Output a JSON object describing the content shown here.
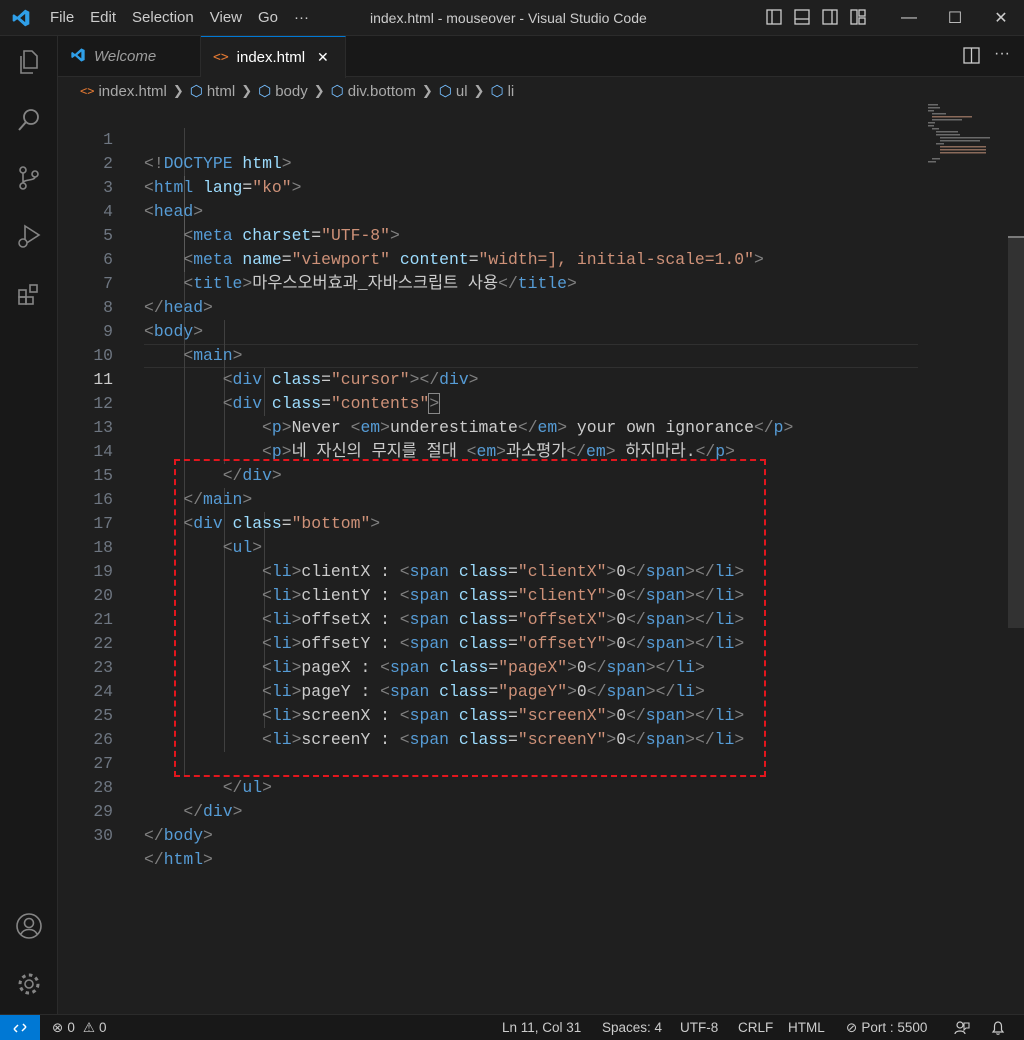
{
  "titlebar": {
    "menu": [
      "File",
      "Edit",
      "Selection",
      "View",
      "Go",
      "···"
    ],
    "window_title": "index.html - mouseover - Visual Studio Code"
  },
  "tabs": [
    {
      "label": "Welcome"
    },
    {
      "label": "index.html",
      "close": "✕"
    }
  ],
  "breadcrumb": [
    "index.html",
    "html",
    "body",
    "div.bottom",
    "ul",
    "li"
  ],
  "lines": [
    "1",
    "2",
    "3",
    "4",
    "5",
    "6",
    "7",
    "8",
    "9",
    "10",
    "11",
    "12",
    "13",
    "14",
    "15",
    "16",
    "17",
    "18",
    "19",
    "20",
    "21",
    "22",
    "23",
    "24",
    "25",
    "26",
    "27",
    "28",
    "29",
    "30"
  ],
  "code": {
    "doctype": "html",
    "lang": "\"ko\"",
    "charset": "\"UTF-8\"",
    "viewport_name": "\"viewport\"",
    "viewport_content": "\"width=], initial-scale=1.0\"",
    "title_text": "마우스오버효과_자바스크립트 사용",
    "cursor_class": "\"cursor\"",
    "contents_class": "\"contents\"",
    "p1_before": "Never ",
    "p1_em": "underestimate",
    "p1_after": " your own ignorance",
    "p2_before": "네 자신의 무지를 절대 ",
    "p2_em": "과소평가",
    "p2_after": " 하지마라.",
    "bottom_class": "\"bottom\"",
    "items": [
      {
        "label": "clientX : ",
        "cls": "\"clientX\"",
        "val": "0"
      },
      {
        "label": "clientY : ",
        "cls": "\"clientY\"",
        "val": "0"
      },
      {
        "label": "offsetX : ",
        "cls": "\"offsetX\"",
        "val": "0"
      },
      {
        "label": "offsetY : ",
        "cls": "\"offsetY\"",
        "val": "0"
      },
      {
        "label": "pageX : ",
        "cls": "\"pageX\"",
        "val": "0"
      },
      {
        "label": "pageY : ",
        "cls": "\"pageY\"",
        "val": "0"
      },
      {
        "label": "screenX : ",
        "cls": "\"screenX\"",
        "val": "0"
      },
      {
        "label": "screenY : ",
        "cls": "\"screenY\"",
        "val": "0"
      }
    ]
  },
  "statusbar": {
    "errors": "0",
    "warnings": "0",
    "position": "Ln 11, Col 31",
    "spaces": "Spaces: 4",
    "encoding": "UTF-8",
    "eol": "CRLF",
    "language": "HTML",
    "port": "Port : 5500"
  },
  "colors": {
    "accent": "#0078d4",
    "highlight_box": "#e3161d",
    "tag": "#569cd6",
    "attr": "#9cdcfe",
    "string": "#ce9178"
  }
}
